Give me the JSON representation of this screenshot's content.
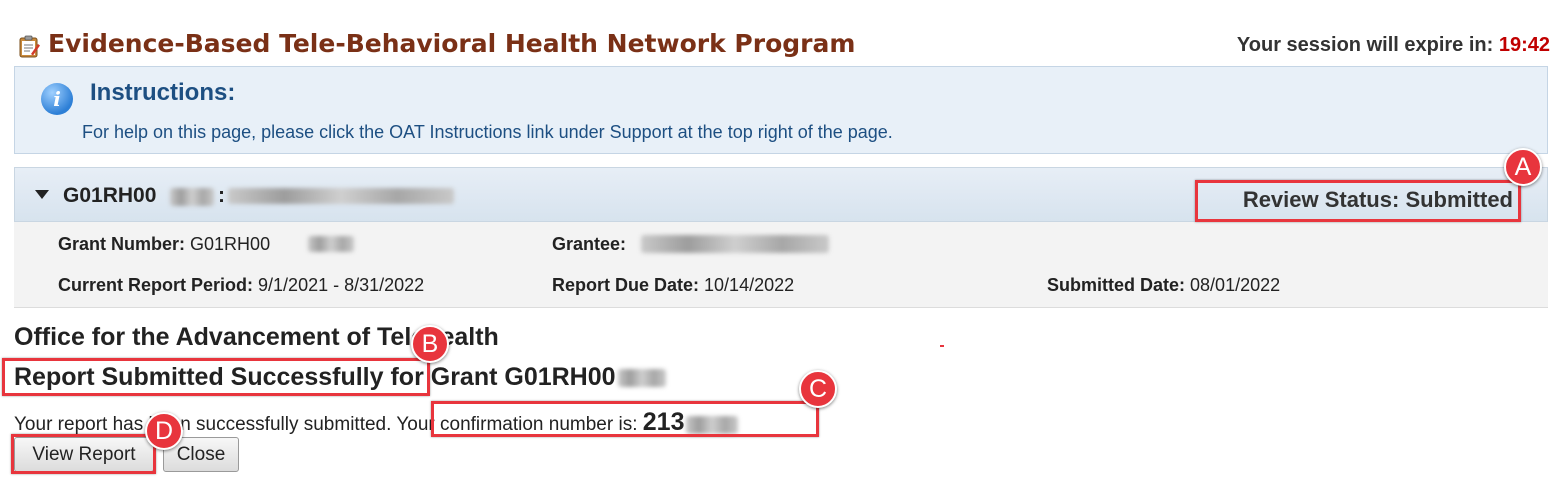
{
  "header": {
    "title": "Evidence-Based Tele-Behavioral Health Network Program",
    "session_label": "Your session will expire in:",
    "session_timer": "19:42",
    "icon": "clipboard-icon"
  },
  "instructions": {
    "icon": "info-icon",
    "title": "Instructions:",
    "text": "For help on this page, please click the OAT Instructions link under Support at the top right of the page."
  },
  "grant_panel": {
    "grant_id_prefix": "G01RH00",
    "separator": ":",
    "review_status_label": "Review Status:",
    "review_status_value": "Submitted",
    "fields": {
      "grant_number_label": "Grant Number:",
      "grant_number_value": "G01RH00",
      "grantee_label": "Grantee:",
      "current_period_label": "Current Report Period:",
      "current_period_value": "9/1/2021 - 8/31/2022",
      "due_date_label": "Report Due Date:",
      "due_date_value": "10/14/2022",
      "submitted_date_label": "Submitted Date:",
      "submitted_date_value": "08/01/2022"
    }
  },
  "content": {
    "office": "Office for the Advancement of Telehealth",
    "success_heading": "Report Submitted Successfully",
    "success_heading_suffix": "for Grant G01RH00",
    "message": "Your report has been successfully submitted.",
    "confirmation_label": "Your confirmation number is:",
    "confirmation_number": "213"
  },
  "buttons": {
    "view_report": "View Report",
    "close": "Close"
  },
  "annotations": {
    "a": "A",
    "b": "B",
    "c": "C",
    "d": "D",
    "color": "#e8353d"
  }
}
